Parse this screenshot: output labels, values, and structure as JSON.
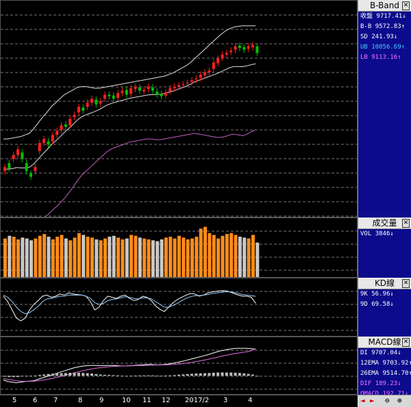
{
  "colors": {
    "up": "#ff2020",
    "down": "#00c000",
    "vol_up": "#ff8c1a",
    "vol_down": "#c8c8c8",
    "band": "#e0e0e0",
    "lb": "#c060c0",
    "k": "#ffffff",
    "d": "#9ad0ff"
  },
  "bband": {
    "title": "B-Band",
    "rows": [
      {
        "label": "收盤",
        "value": "9717.41",
        "arrow": "↓",
        "color": "#ffffff"
      },
      {
        "label": "B-B",
        "value": "9572.83",
        "arrow": "↑",
        "color": "#ffffff"
      },
      {
        "label": "SD",
        "value": "241.93",
        "arrow": "↓",
        "color": "#ffffff"
      },
      {
        "label": "UB",
        "value": "10056.69",
        "arrow": "↑",
        "color": "#4ad0ff"
      },
      {
        "label": "LB",
        "value": "9113.16",
        "arrow": "↑",
        "color": "#ff70ff"
      }
    ]
  },
  "volume": {
    "title": "成交量",
    "rows": [
      {
        "label": "VOL",
        "value": "3846",
        "arrow": "↓",
        "color": "#ffffff"
      }
    ]
  },
  "kd": {
    "title": "KD線",
    "rows": [
      {
        "label": "9K",
        "value": "56.96",
        "arrow": "↓",
        "color": "#ffffff"
      },
      {
        "label": "9D",
        "value": "69.58",
        "arrow": "↓",
        "color": "#ffffff"
      }
    ]
  },
  "macd": {
    "title": "MACD線",
    "rows": [
      {
        "label": "DI",
        "value": "9707.04",
        "arrow": "↓",
        "color": "#ffffff"
      },
      {
        "label": "12EMA",
        "value": "9703.92",
        "arrow": "↑",
        "color": "#ffffff"
      },
      {
        "label": "26EMA",
        "value": "9514.70",
        "arrow": "↑",
        "color": "#ffffff"
      },
      {
        "label": "DIF",
        "value": "189.23",
        "arrow": "↓",
        "color": "#ff70ff"
      },
      {
        "label": "OMACD",
        "value": "192.71",
        "arrow": "↓",
        "color": "#ff70ff"
      }
    ]
  },
  "xaxis": {
    "labels": [
      "5",
      "6",
      "7",
      "8",
      "9",
      "10",
      "11",
      "12",
      "2017/2",
      "3",
      "4"
    ]
  },
  "nav": {
    "prev": "◄",
    "next": "►",
    "zoom_out": "⊖",
    "zoom_in": "⊕"
  },
  "chart_data": {
    "type": "candlestick",
    "candles_note": "approximate index values, one point per trading day",
    "closes": [
      8300,
      8280,
      8450,
      8520,
      8400,
      8250,
      8180,
      8300,
      8600,
      8650,
      8580,
      8700,
      8750,
      8820,
      8800,
      8900,
      8950,
      9050,
      9000,
      9100,
      9150,
      9080,
      9120,
      9200,
      9180,
      9150,
      9220,
      9250,
      9200,
      9280,
      9300,
      9250,
      9260,
      9300,
      9250,
      9200,
      9180,
      9230,
      9280,
      9300,
      9320,
      9330,
      9350,
      9380,
      9400,
      9450,
      9480,
      9500,
      9600,
      9650,
      9700,
      9720,
      9750,
      9800,
      9780,
      9760,
      9800,
      9820,
      9717
    ],
    "opens": [
      8250,
      8350,
      8400,
      8450,
      8480,
      8350,
      8220,
      8250,
      8500,
      8600,
      8620,
      8620,
      8700,
      8760,
      8830,
      8820,
      8920,
      8980,
      9040,
      9050,
      9100,
      9140,
      9090,
      9150,
      9200,
      9190,
      9160,
      9220,
      9260,
      9210,
      9270,
      9290,
      9240,
      9270,
      9290,
      9240,
      9210,
      9190,
      9240,
      9280,
      9300,
      9320,
      9340,
      9360,
      9390,
      9410,
      9440,
      9480,
      9520,
      9590,
      9660,
      9700,
      9730,
      9760,
      9810,
      9790,
      9770,
      9790,
      9800
    ],
    "ub": [
      8650,
      8650,
      8660,
      8670,
      8680,
      8700,
      8720,
      8780,
      8850,
      8920,
      8980,
      9050,
      9100,
      9150,
      9200,
      9230,
      9260,
      9290,
      9300,
      9300,
      9290,
      9280,
      9280,
      9290,
      9300,
      9310,
      9320,
      9330,
      9340,
      9350,
      9360,
      9370,
      9380,
      9390,
      9400,
      9410,
      9420,
      9430,
      9450,
      9470,
      9500,
      9530,
      9560,
      9600,
      9650,
      9700,
      9750,
      9800,
      9850,
      9900,
      9950,
      9990,
      10020,
      10040,
      10050,
      10055,
      10056,
      10056,
      10056
    ],
    "lb": [
      7900,
      7900,
      7900,
      7920,
      7900,
      7880,
      7880,
      7900,
      7950,
      8000,
      8050,
      8100,
      8150,
      8200,
      8260,
      8330,
      8400,
      8480,
      8550,
      8600,
      8650,
      8700,
      8750,
      8800,
      8850,
      8880,
      8900,
      8920,
      8940,
      8960,
      8970,
      8980,
      8990,
      9000,
      9000,
      8990,
      8990,
      9000,
      9010,
      9020,
      9030,
      9040,
      9050,
      9060,
      9070,
      9060,
      9050,
      9040,
      9030,
      9020,
      9020,
      9030,
      9050,
      9060,
      9050,
      9040,
      9060,
      9090,
      9113
    ],
    "volume": [
      4300,
      4600,
      4500,
      4200,
      4400,
      4300,
      4100,
      4300,
      4600,
      4800,
      4500,
      4200,
      4500,
      4700,
      4300,
      4100,
      4400,
      4900,
      4700,
      4500,
      4400,
      4200,
      4100,
      4300,
      4500,
      4600,
      4400,
      4200,
      4300,
      4700,
      4600,
      4400,
      4300,
      4200,
      4100,
      4000,
      4200,
      4400,
      4500,
      4300,
      4600,
      4400,
      4200,
      4300,
      4500,
      5400,
      5600,
      4900,
      4700,
      4300,
      4600,
      4800,
      4900,
      4700,
      4500,
      4400,
      4300,
      4700,
      3846
    ],
    "k": [
      70,
      60,
      45,
      30,
      25,
      30,
      45,
      55,
      62,
      70,
      72,
      68,
      70,
      74,
      72,
      76,
      74,
      73,
      72,
      70,
      60,
      45,
      50,
      62,
      70,
      68,
      66,
      70,
      72,
      66,
      62,
      64,
      70,
      68,
      62,
      52,
      46,
      42,
      50,
      58,
      64,
      68,
      72,
      75,
      74,
      70,
      72,
      76,
      78,
      79,
      80,
      80,
      78,
      75,
      72,
      70,
      70,
      68,
      56.96
    ],
    "d": [
      72,
      68,
      60,
      50,
      42,
      38,
      40,
      45,
      52,
      60,
      65,
      66,
      68,
      70,
      70,
      72,
      72,
      72,
      72,
      70,
      66,
      58,
      55,
      57,
      62,
      64,
      65,
      67,
      69,
      68,
      66,
      65,
      67,
      67,
      65,
      60,
      55,
      50,
      50,
      53,
      57,
      62,
      66,
      69,
      71,
      71,
      72,
      73,
      75,
      76,
      77,
      78,
      78,
      77,
      75,
      73,
      72,
      71,
      69.58
    ],
    "dif": [
      -30,
      -40,
      -45,
      -50,
      -45,
      -40,
      -38,
      -35,
      -25,
      -15,
      -5,
      5,
      15,
      25,
      35,
      45,
      55,
      62,
      68,
      72,
      74,
      74,
      72,
      72,
      74,
      74,
      72,
      70,
      70,
      72,
      74,
      76,
      78,
      80,
      80,
      78,
      78,
      80,
      84,
      90,
      96,
      102,
      110,
      118,
      126,
      134,
      142,
      150,
      160,
      170,
      178,
      184,
      190,
      194,
      196,
      196,
      195,
      193,
      189.23
    ],
    "macd": [
      -20,
      -25,
      -30,
      -35,
      -38,
      -39,
      -39,
      -38,
      -35,
      -31,
      -26,
      -20,
      -13,
      -6,
      2,
      10,
      18,
      26,
      34,
      41,
      47,
      53,
      57,
      60,
      63,
      66,
      68,
      69,
      70,
      71,
      72,
      73,
      74,
      75,
      76,
      77,
      77,
      78,
      79,
      81,
      83,
      86,
      90,
      94,
      99,
      105,
      111,
      117,
      124,
      131,
      138,
      145,
      151,
      157,
      162,
      167,
      172,
      178,
      192.71
    ]
  }
}
